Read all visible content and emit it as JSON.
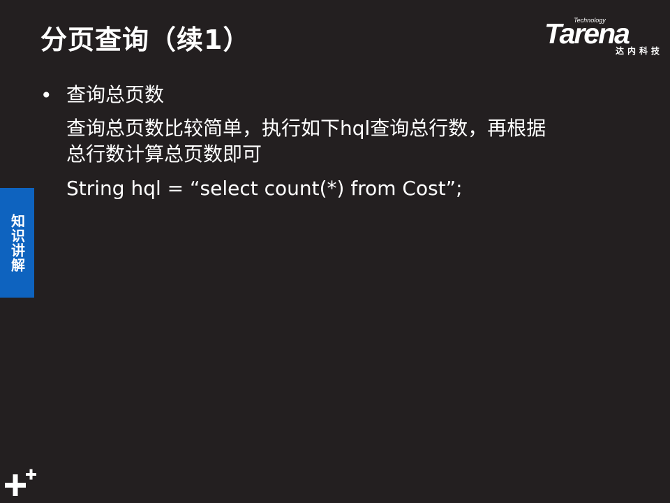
{
  "slide": {
    "title": "分页查询（续1）",
    "logo": {
      "small_text": "Technology",
      "wordmark": "Tarena",
      "chinese": "达内科技"
    },
    "side_tab": {
      "label": "知识讲解",
      "color": "#0e63bf"
    },
    "content": {
      "bullet": "•",
      "heading": "查询总页数",
      "paragraph_line_1": "查询总页数比较简单，执行如下hql查询总行数，再根据",
      "paragraph_line_2": "总行数计算总页数即可",
      "code": "String hql = “select count(*) from Cost”;"
    },
    "decoration": {
      "icon": "plus-icon"
    },
    "colors": {
      "background": "#231f20",
      "text": "#ffffff",
      "accent": "#0e63bf"
    }
  }
}
